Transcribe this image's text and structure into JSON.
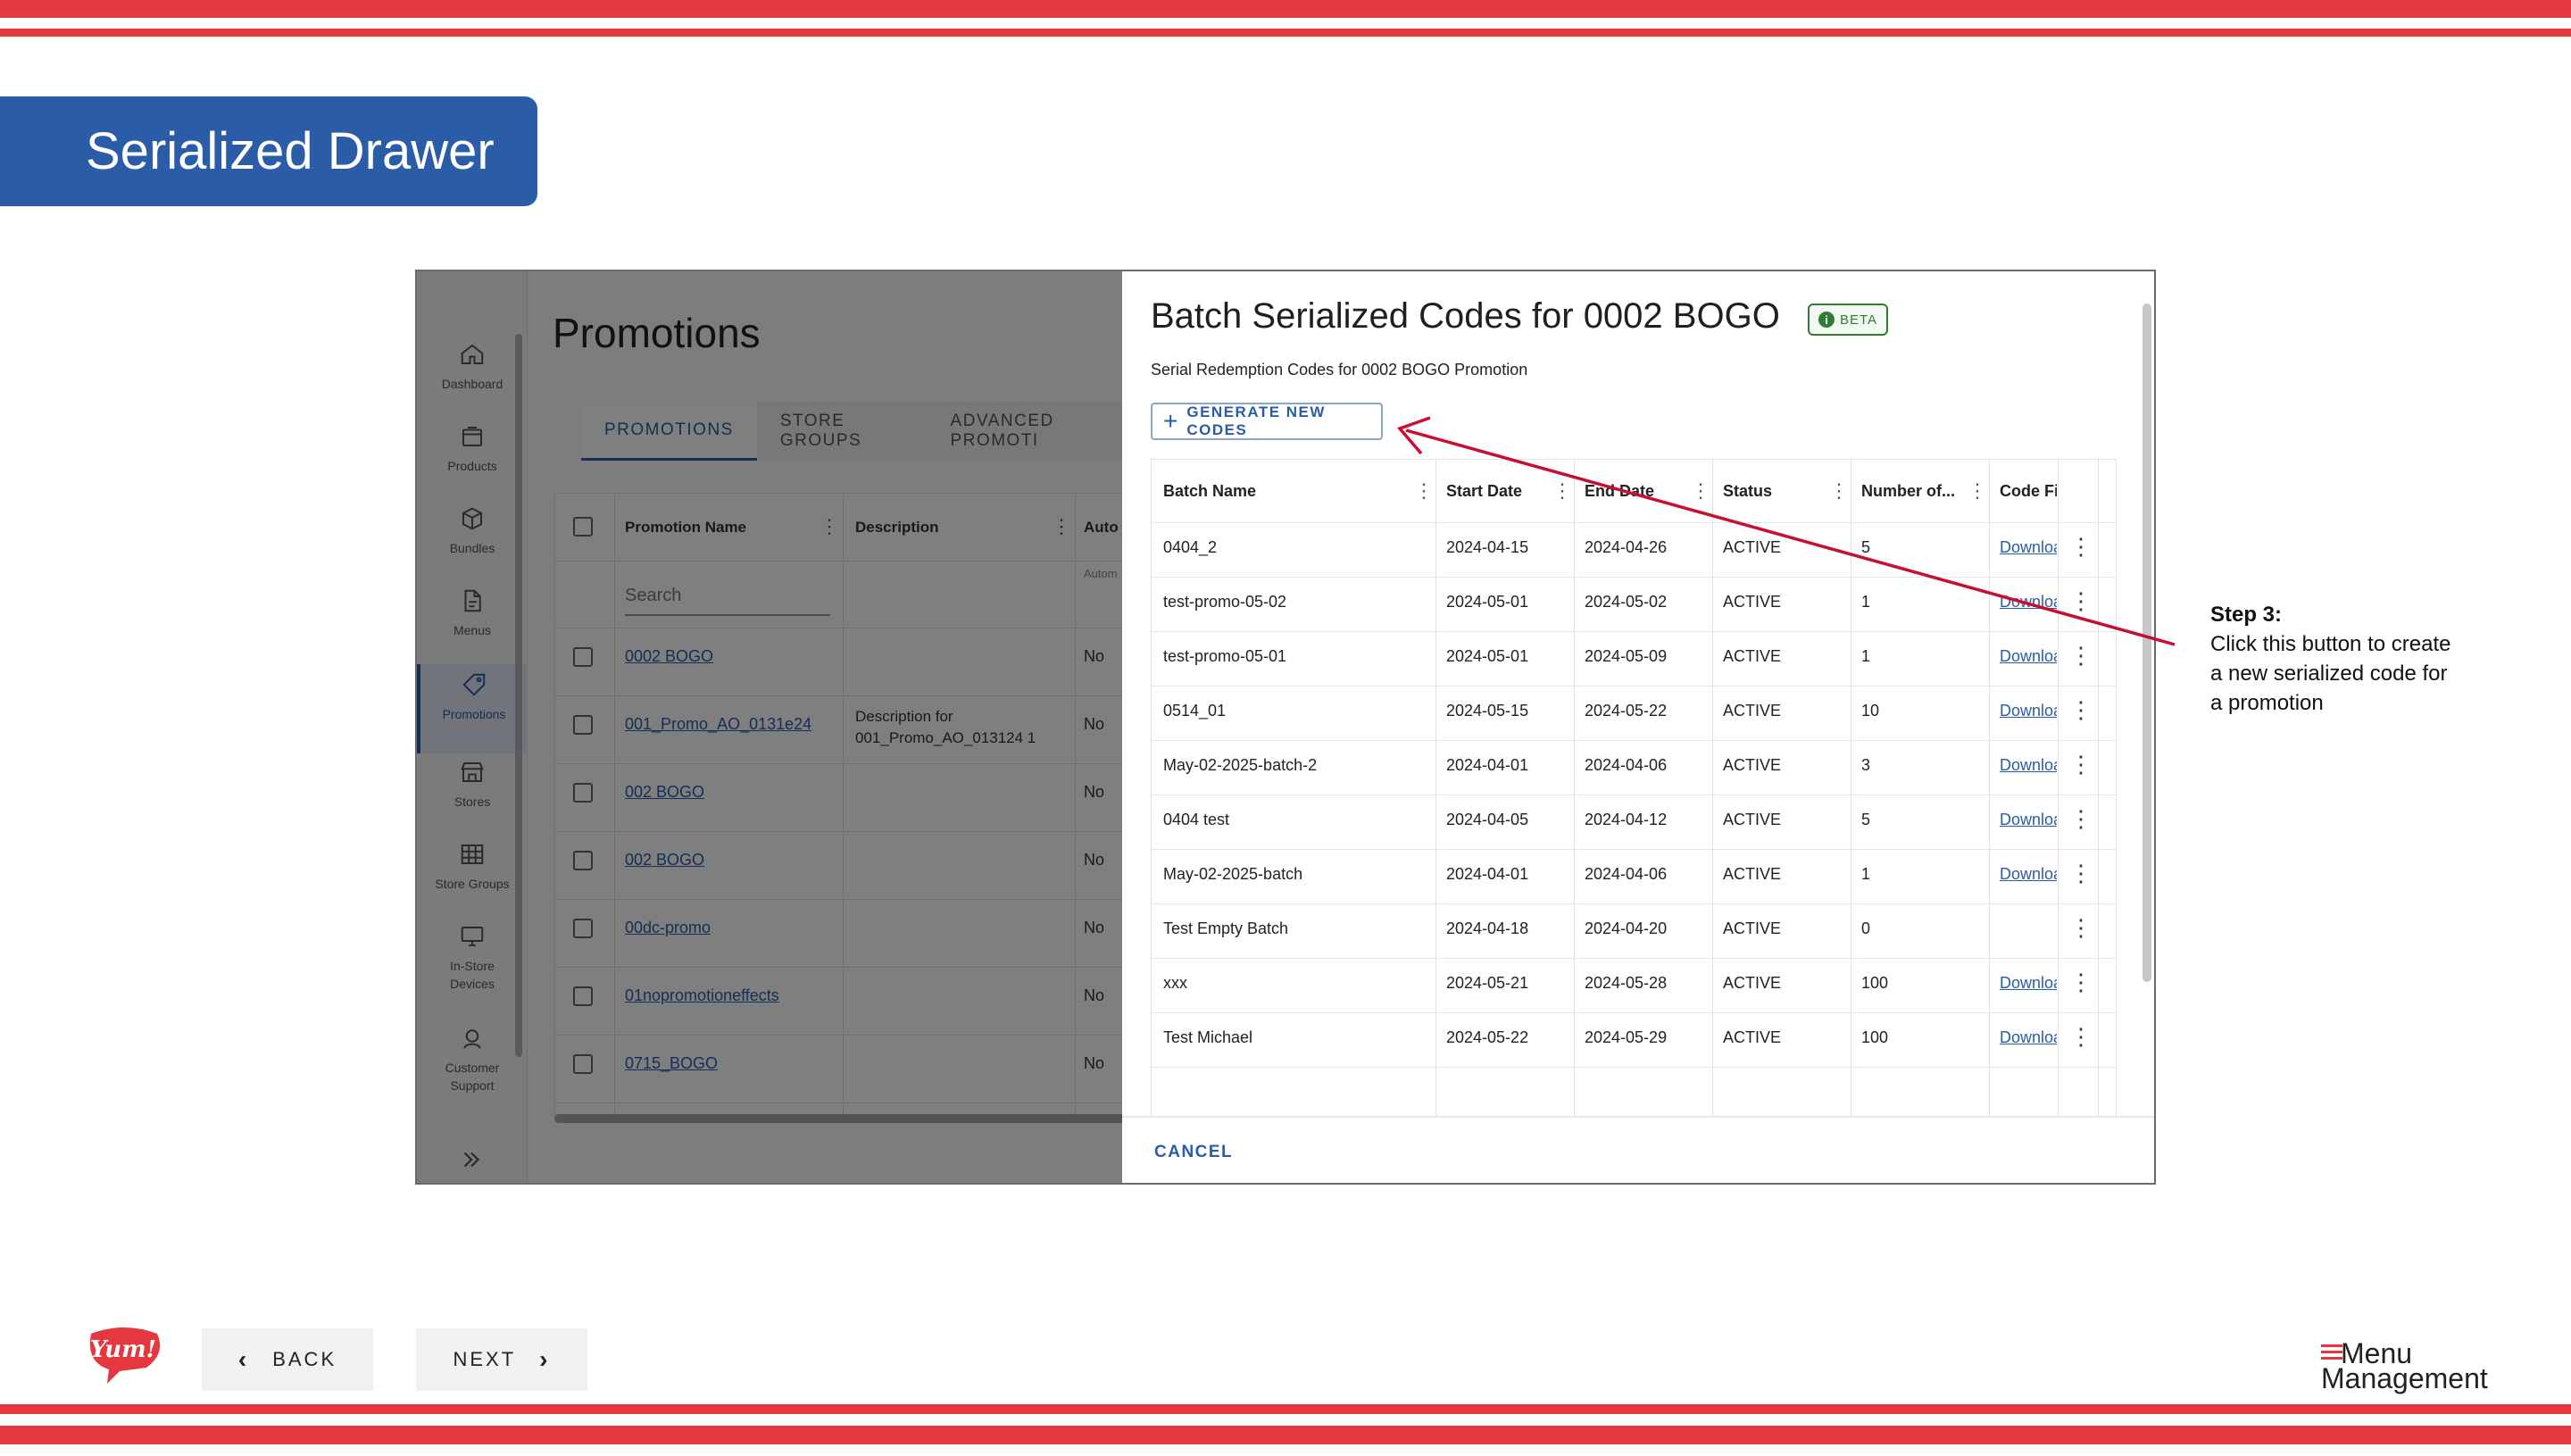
{
  "slide": {
    "title": "Serialized Drawer",
    "note_heading": "Step 3:",
    "note_body": "Click this button to create a new serialized code for a promotion",
    "back_label": "BACK",
    "next_label": "NEXT",
    "logo_text": "Yum!",
    "brand_line1": "Menu",
    "brand_line2": "Management",
    "accent_red": "#e4373f",
    "accent_blue": "#2a5ca8"
  },
  "app": {
    "title": "Promotions",
    "rail": [
      {
        "label": "Dashboard",
        "icon": "home-icon"
      },
      {
        "label": "Products",
        "icon": "box-icon"
      },
      {
        "label": "Bundles",
        "icon": "cube-icon"
      },
      {
        "label": "Menus",
        "icon": "document-icon"
      },
      {
        "label": "Promotions",
        "icon": "tag-icon",
        "active": true
      },
      {
        "label": "Stores",
        "icon": "store-icon"
      },
      {
        "label": "Store Groups",
        "icon": "grid-icon"
      },
      {
        "label": "In-Store Devices",
        "icon": "monitor-icon"
      },
      {
        "label": "Customer Support",
        "icon": "headset-icon"
      }
    ],
    "tabs": [
      "PROMOTIONS",
      "STORE GROUPS",
      "ADVANCED PROMOTI"
    ],
    "columns": [
      "Promotion Name",
      "Description",
      "Auto"
    ],
    "auto_subheader": "Autom",
    "search_placeholder": "Search",
    "rows": [
      {
        "name": "0002 BOGO",
        "description": "",
        "auto": "No"
      },
      {
        "name": "001_Promo_AO_0131e24",
        "description": "Description for 001_Promo_AO_013124 1",
        "auto": "No"
      },
      {
        "name": "002 BOGO",
        "description": "",
        "auto": "No"
      },
      {
        "name": "002 BOGO",
        "description": "",
        "auto": "No"
      },
      {
        "name": "00dc-promo",
        "description": "",
        "auto": "No"
      },
      {
        "name": "01nopromotioneffects",
        "description": "",
        "auto": "No"
      },
      {
        "name": "0715_BOGO",
        "description": "",
        "auto": "No"
      }
    ]
  },
  "drawer": {
    "title": "Batch Serialized Codes for 0002 BOGO",
    "beta": "BETA",
    "subtitle": "Serial Redemption Codes for 0002 BOGO Promotion",
    "generate_label": "GENERATE NEW CODES",
    "cancel_label": "CANCEL",
    "columns": [
      "Batch Name",
      "Start Date",
      "End Date",
      "Status",
      "Number of...",
      "Code Fi"
    ],
    "rows": [
      {
        "batch": "0404_2",
        "start": "2024-04-15",
        "end": "2024-04-26",
        "status": "ACTIVE",
        "count": "5",
        "file": "Downloa"
      },
      {
        "batch": "test-promo-05-02",
        "start": "2024-05-01",
        "end": "2024-05-02",
        "status": "ACTIVE",
        "count": "1",
        "file": "Downloa"
      },
      {
        "batch": "test-promo-05-01",
        "start": "2024-05-01",
        "end": "2024-05-09",
        "status": "ACTIVE",
        "count": "1",
        "file": "Downloa"
      },
      {
        "batch": "0514_01",
        "start": "2024-05-15",
        "end": "2024-05-22",
        "status": "ACTIVE",
        "count": "10",
        "file": "Downloa"
      },
      {
        "batch": "May-02-2025-batch-2",
        "start": "2024-04-01",
        "end": "2024-04-06",
        "status": "ACTIVE",
        "count": "3",
        "file": "Downloa"
      },
      {
        "batch": "0404 test",
        "start": "2024-04-05",
        "end": "2024-04-12",
        "status": "ACTIVE",
        "count": "5",
        "file": "Downloa"
      },
      {
        "batch": "May-02-2025-batch",
        "start": "2024-04-01",
        "end": "2024-04-06",
        "status": "ACTIVE",
        "count": "1",
        "file": "Downloa"
      },
      {
        "batch": "Test Empty Batch",
        "start": "2024-04-18",
        "end": "2024-04-20",
        "status": "ACTIVE",
        "count": "0",
        "file": ""
      },
      {
        "batch": "xxx",
        "start": "2024-05-21",
        "end": "2024-05-28",
        "status": "ACTIVE",
        "count": "100",
        "file": "Downloa"
      },
      {
        "batch": "Test Michael",
        "start": "2024-05-22",
        "end": "2024-05-29",
        "status": "ACTIVE",
        "count": "100",
        "file": "Downloa"
      }
    ]
  }
}
